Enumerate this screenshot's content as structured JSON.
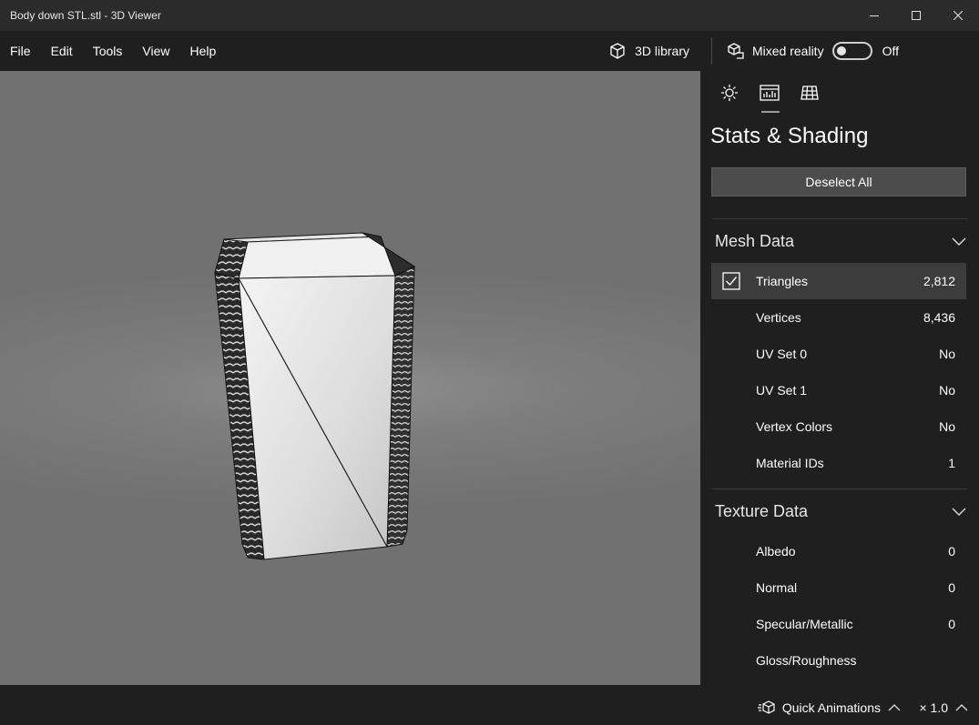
{
  "window": {
    "title": "Body down STL.stl - 3D Viewer"
  },
  "menu": {
    "items": [
      "File",
      "Edit",
      "Tools",
      "View",
      "Help"
    ],
    "library_label": "3D library",
    "mixed_reality_label": "Mixed reality",
    "toggle_state": "Off"
  },
  "panel": {
    "title": "Stats & Shading",
    "deselect_label": "Deselect All",
    "mesh_section": "Mesh Data",
    "mesh_rows": [
      {
        "label": "Triangles",
        "value": "2,812",
        "checked": true
      },
      {
        "label": "Vertices",
        "value": "8,436"
      },
      {
        "label": "UV Set 0",
        "value": "No"
      },
      {
        "label": "UV Set 1",
        "value": "No"
      },
      {
        "label": "Vertex Colors",
        "value": "No"
      },
      {
        "label": "Material IDs",
        "value": "1"
      }
    ],
    "texture_section": "Texture Data",
    "texture_rows": [
      {
        "label": "Albedo",
        "value": "0"
      },
      {
        "label": "Normal",
        "value": "0"
      },
      {
        "label": "Specular/Metallic",
        "value": "0"
      },
      {
        "label": "Gloss/Roughness",
        "value": ""
      }
    ]
  },
  "bottom": {
    "quick_animations_label": "Quick Animations",
    "speed_label": "× 1.0"
  },
  "colors": {
    "background": "#1f1f1f",
    "titlebar": "#2b2b2b",
    "viewport": "#7a7a7a",
    "selected_row": "#3c3c3c",
    "button": "#4c4c4c"
  }
}
